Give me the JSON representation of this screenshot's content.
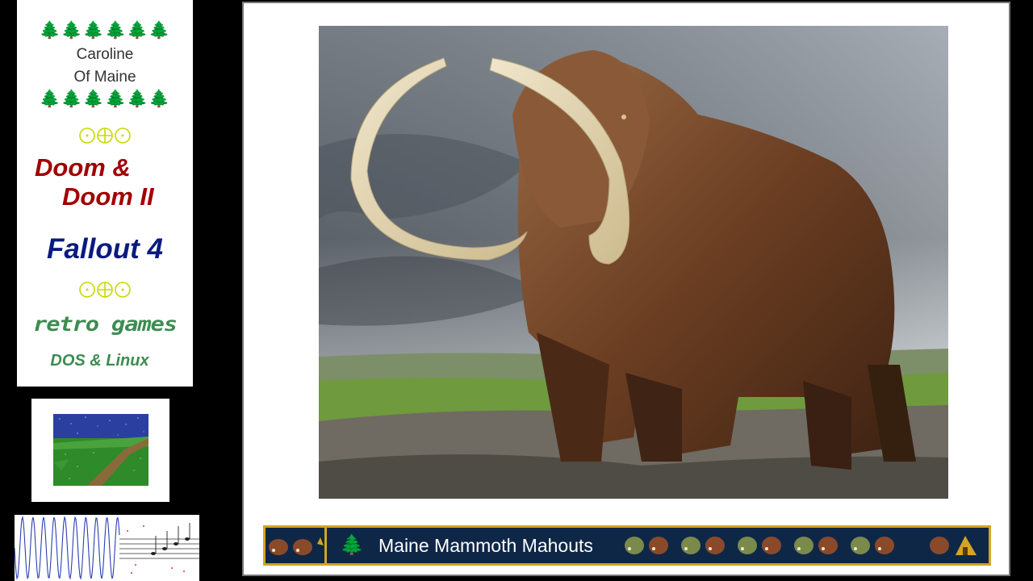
{
  "sidebar": {
    "tree_glyph": "🌲🌲🌲🌲🌲🌲",
    "channel_line1": "Caroline",
    "channel_line2": "Of Maine",
    "doom_line1": "Doom &",
    "doom_line2": "Doom II",
    "fallout": "Fallout 4",
    "retro": "retro games",
    "dos_linux": "DOS & Linux"
  },
  "ticker": {
    "text": "Maine Mammoth Mahouts",
    "tree_icon": "🌲"
  },
  "colors": {
    "doom": "#a00000",
    "fallout": "#0a1a80",
    "retro": "#3c8c50",
    "ticker_bg": "#0f2747",
    "ticker_border": "#d4a520",
    "tree": "#1a8a1a"
  },
  "icons": [
    "tree-icon",
    "ornament-icon",
    "mammoth-icon",
    "hut-icon"
  ]
}
